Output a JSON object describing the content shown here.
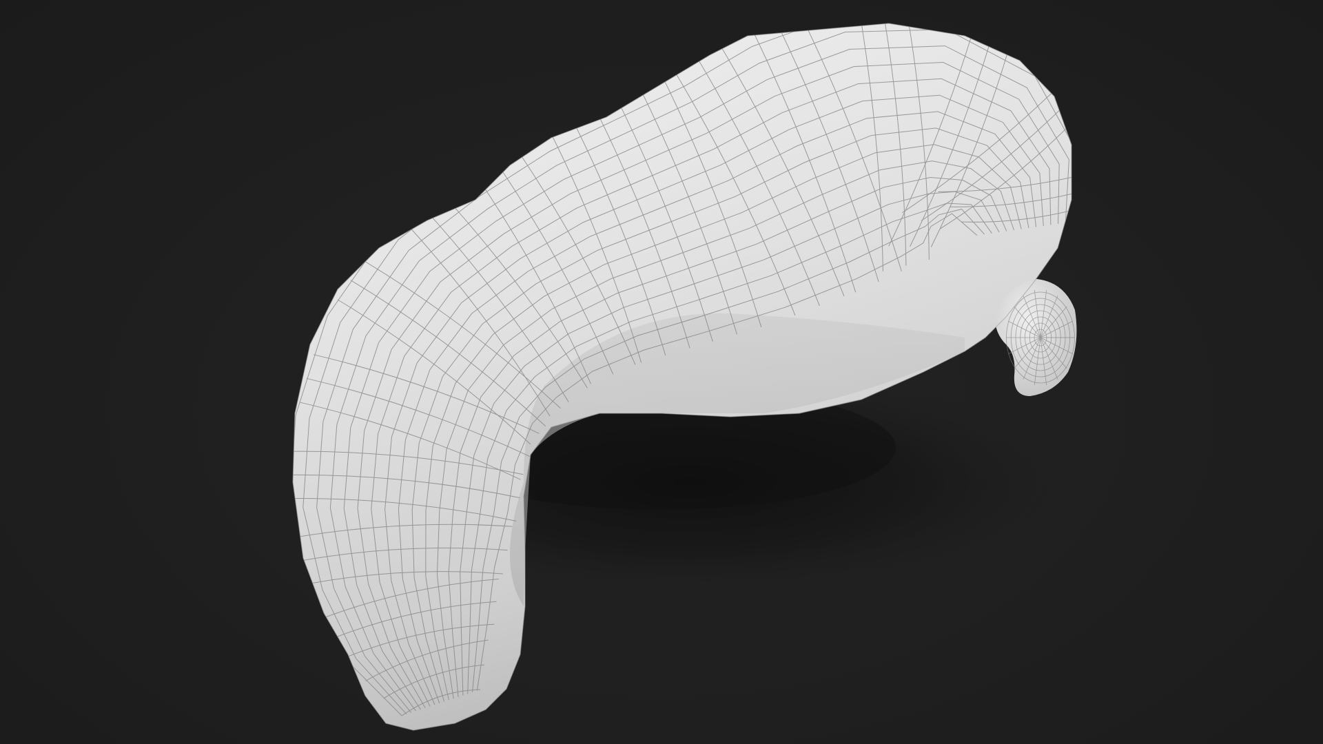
{
  "scene": {
    "colors": {
      "background": "#1e1e1e",
      "surface": "#e6e6e6",
      "surface_shade": "#bdbdbd",
      "wireframe": "#7f7f7f",
      "shadow": "#0f0f0f"
    }
  }
}
